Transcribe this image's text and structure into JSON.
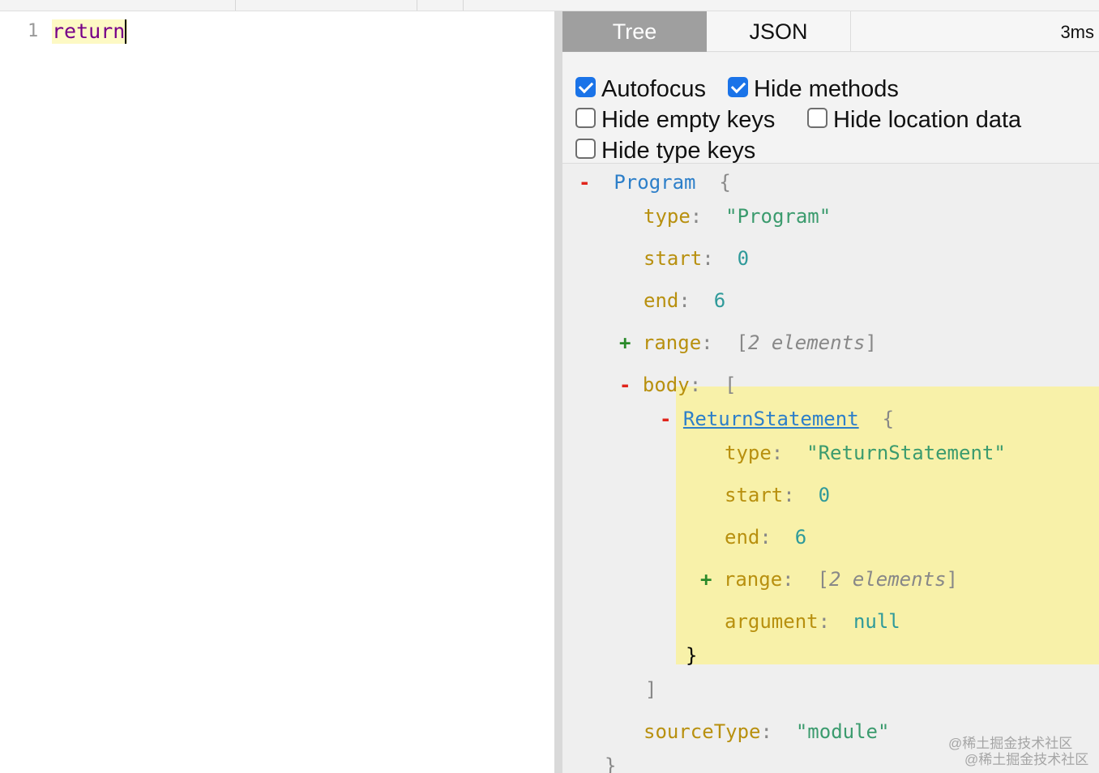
{
  "editor": {
    "line_number": "1",
    "code": "return"
  },
  "output": {
    "tabs": [
      {
        "label": "Tree",
        "active": true
      },
      {
        "label": "JSON",
        "active": false
      }
    ],
    "timing": "3ms",
    "options": [
      {
        "label": "Autofocus",
        "checked": true
      },
      {
        "label": "Hide methods",
        "checked": true
      },
      {
        "label": "Hide empty keys",
        "checked": false
      },
      {
        "label": "Hide location data",
        "checked": false
      },
      {
        "label": "Hide type keys",
        "checked": false
      }
    ]
  },
  "tree": {
    "program": {
      "name": "Program",
      "toggle": "-",
      "open_brace": "{",
      "close_brace": "}",
      "type_key": "type",
      "type_val": "\"Program\"",
      "start_key": "start",
      "start_val": "0",
      "end_key": "end",
      "end_val": "6",
      "range_toggle": "+",
      "range_key": "range",
      "range_summary": "2 elements",
      "body_toggle": "-",
      "body_key": "body",
      "body_open": "[",
      "body_close": "]",
      "source_type_key": "sourceType",
      "source_type_val": "\"module\""
    },
    "return_statement": {
      "name": "ReturnStatement",
      "toggle": "-",
      "open_brace": "{",
      "close_brace": "}",
      "type_key": "type",
      "type_val": "\"ReturnStatement\"",
      "start_key": "start",
      "start_val": "0",
      "end_key": "end",
      "end_val": "6",
      "range_toggle": "+",
      "range_key": "range",
      "range_summary": "2 elements",
      "argument_key": "argument",
      "argument_val": "null"
    },
    "colon": ":",
    "lbracket": "[",
    "rbracket": "]"
  },
  "watermark": [
    "@稀土掘金技术社区",
    "@稀土掘金技术社区"
  ],
  "colors": {
    "tab_active_bg": "#9f9f9f",
    "checkbox_checked": "#1a73e8",
    "highlight": "#f8f1a9",
    "keyword": "#770088",
    "toggle_minus": "#e0241b",
    "toggle_plus": "#2a8a2a",
    "node_name": "#2d7fc9",
    "key": "#b8900f",
    "string": "#3b9b6e",
    "number": "#2f9a9a"
  }
}
